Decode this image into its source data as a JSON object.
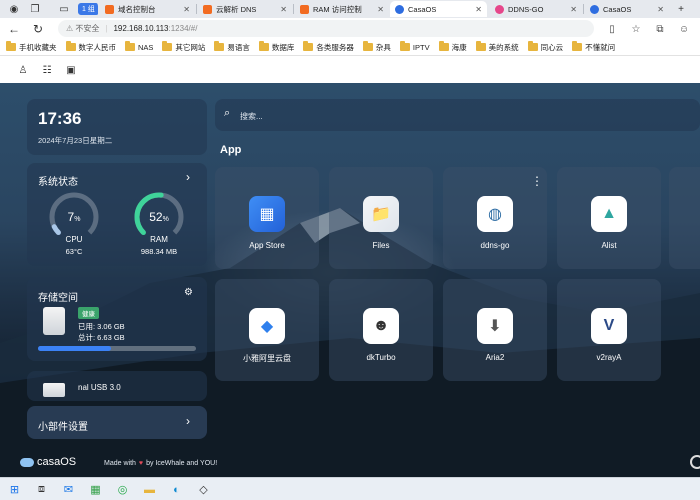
{
  "tabs": [
    {
      "label": "1 组",
      "kind": "group"
    },
    {
      "label": "域名控制台",
      "color": "#f26b21"
    },
    {
      "label": "云解析 DNS",
      "color": "#f26b21"
    },
    {
      "label": "RAM 访问控制",
      "color": "#f26b21"
    },
    {
      "label": "CasaOS",
      "color": "#2e6de0",
      "active": true
    },
    {
      "label": "DDNS-GO",
      "color": "#e6468a"
    },
    {
      "label": "CasaOS",
      "color": "#2e6de0"
    }
  ],
  "address": {
    "warning": "不安全",
    "host": "192.168.10.113",
    "path": ":1234/#/"
  },
  "bookmarks": [
    "手机收藏夹",
    "数字人民币",
    "NAS",
    "其它网站",
    "易语言",
    "数据库",
    "各类服务器",
    "杂具",
    "IPTV",
    "海康",
    "美的系统",
    "同心云",
    "不懂就问"
  ],
  "widgets": {
    "time": "17:36",
    "date": "2024年7月23日星期二",
    "system": {
      "title": "系统状态",
      "cpu": {
        "value": "7",
        "unit": "%",
        "label": "CPU",
        "sub": "63°C",
        "percent": 7
      },
      "ram": {
        "value": "52",
        "unit": "%",
        "label": "RAM",
        "sub": "988.34 MB",
        "percent": 52
      }
    },
    "storage": {
      "title": "存储空间",
      "status": "健康",
      "used": "已用: 3.06 GB",
      "total": "总计: 6.63 GB",
      "percent": 46
    },
    "usb": {
      "title": "nal USB 3.0"
    },
    "widget_settings": "小部件设置"
  },
  "search": {
    "placeholder": "搜索..."
  },
  "apps_title": "App",
  "apps": [
    {
      "name": "App Store",
      "icon": "app-store-icon"
    },
    {
      "name": "Files",
      "icon": "files-icon"
    },
    {
      "name": "ddns-go",
      "icon": "ddns-icon"
    },
    {
      "name": "Alist",
      "icon": "alist-icon"
    },
    {
      "name": "小雅阿里云盘",
      "icon": "xiaoya-icon"
    },
    {
      "name": "dkTurbo",
      "icon": "dkturbo-icon"
    },
    {
      "name": "Aria2",
      "icon": "aria2-icon"
    },
    {
      "name": "v2rayA",
      "icon": "v2raya-icon"
    }
  ],
  "footer": {
    "brand": "casaOS",
    "made_prefix": "Made with",
    "made_suffix": "by IceWhale and YOU!"
  }
}
